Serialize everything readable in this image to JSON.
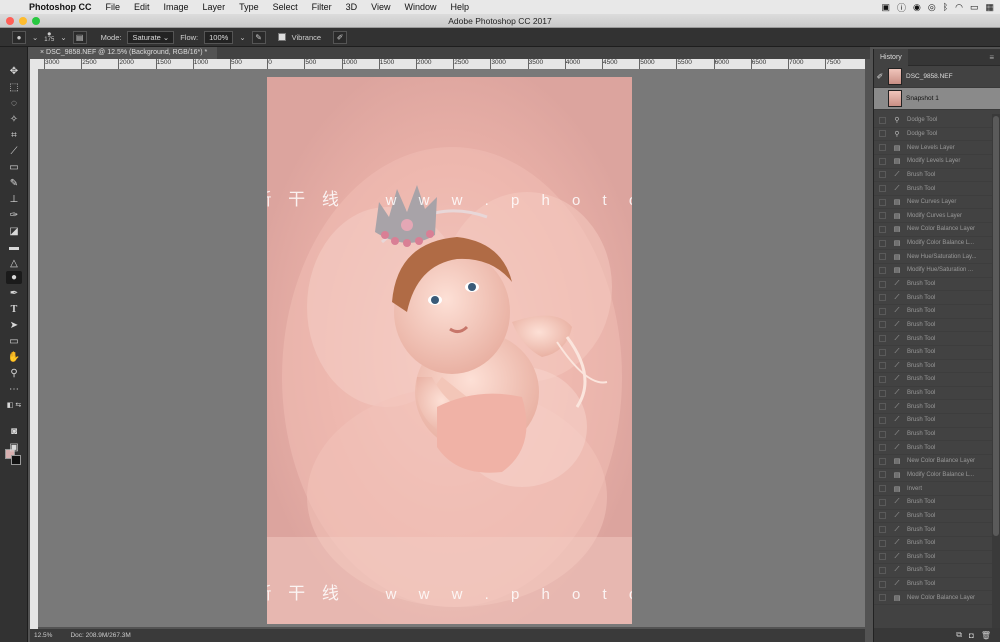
{
  "menubar": {
    "app": "Photoshop CC",
    "items": [
      "File",
      "Edit",
      "Image",
      "Layer",
      "Type",
      "Select",
      "Filter",
      "3D",
      "View",
      "Window",
      "Help"
    ]
  },
  "window": {
    "title": "Adobe Photoshop CC 2017"
  },
  "options": {
    "brush_size": "175",
    "mode_label": "Mode:",
    "mode_value": "Saturate",
    "flow_label": "Flow:",
    "flow_value": "100%",
    "vibrance_label": "Vibrance"
  },
  "document": {
    "tab": "DSC_9858.NEF @ 12.5% (Background, RGB/16*) *"
  },
  "ruler": {
    "labels": [
      "3000",
      "2500",
      "2000",
      "1500",
      "1000",
      "500",
      "0",
      "500",
      "1000",
      "1500",
      "2000",
      "2500",
      "3000",
      "3500",
      "4000",
      "4500",
      "5000",
      "5500",
      "6000",
      "6500",
      "7000",
      "7500"
    ]
  },
  "canvas": {
    "watermark_cn": "摄 影 新 干 线",
    "watermark_url": "w w w . p h o t o s k s . v i p"
  },
  "status": {
    "zoom": "12.5%",
    "doc": "Doc: 208.9M/267.3M"
  },
  "history": {
    "tab": "History",
    "source_snapshot": "DSC_9858.NEF",
    "snapshot": "Snapshot 1",
    "states": [
      {
        "icon": "dodge-icon",
        "label": "Dodge Tool"
      },
      {
        "icon": "dodge-icon",
        "label": "Dodge Tool"
      },
      {
        "icon": "layer-icon",
        "label": "New Levels Layer"
      },
      {
        "icon": "layer-icon",
        "label": "Modify Levels Layer"
      },
      {
        "icon": "brush-icon",
        "label": "Brush Tool"
      },
      {
        "icon": "brush-icon",
        "label": "Brush Tool"
      },
      {
        "icon": "layer-icon",
        "label": "New Curves Layer"
      },
      {
        "icon": "layer-icon",
        "label": "Modify Curves Layer"
      },
      {
        "icon": "layer-icon",
        "label": "New Color Balance Layer"
      },
      {
        "icon": "layer-icon",
        "label": "Modify Color Balance L..."
      },
      {
        "icon": "layer-icon",
        "label": "New Hue/Saturation Lay..."
      },
      {
        "icon": "layer-icon",
        "label": "Modify Hue/Saturation ..."
      },
      {
        "icon": "brush-icon",
        "label": "Brush Tool"
      },
      {
        "icon": "brush-icon",
        "label": "Brush Tool"
      },
      {
        "icon": "brush-icon",
        "label": "Brush Tool"
      },
      {
        "icon": "brush-icon",
        "label": "Brush Tool"
      },
      {
        "icon": "brush-icon",
        "label": "Brush Tool"
      },
      {
        "icon": "brush-icon",
        "label": "Brush Tool"
      },
      {
        "icon": "brush-icon",
        "label": "Brush Tool"
      },
      {
        "icon": "brush-icon",
        "label": "Brush Tool"
      },
      {
        "icon": "brush-icon",
        "label": "Brush Tool"
      },
      {
        "icon": "brush-icon",
        "label": "Brush Tool"
      },
      {
        "icon": "brush-icon",
        "label": "Brush Tool"
      },
      {
        "icon": "brush-icon",
        "label": "Brush Tool"
      },
      {
        "icon": "brush-icon",
        "label": "Brush Tool"
      },
      {
        "icon": "layer-icon",
        "label": "New Color Balance Layer"
      },
      {
        "icon": "layer-icon",
        "label": "Modify Color Balance L..."
      },
      {
        "icon": "layer-icon",
        "label": "Invert"
      },
      {
        "icon": "brush-icon",
        "label": "Brush Tool"
      },
      {
        "icon": "brush-icon",
        "label": "Brush Tool"
      },
      {
        "icon": "brush-icon",
        "label": "Brush Tool"
      },
      {
        "icon": "brush-icon",
        "label": "Brush Tool"
      },
      {
        "icon": "brush-icon",
        "label": "Brush Tool"
      },
      {
        "icon": "brush-icon",
        "label": "Brush Tool"
      },
      {
        "icon": "brush-icon",
        "label": "Brush Tool"
      },
      {
        "icon": "layer-icon",
        "label": "New Color Balance Layer"
      }
    ]
  },
  "colors": {
    "foreground": "#d8b0b0",
    "background": "#111111",
    "canvas_bg": "#797979"
  }
}
